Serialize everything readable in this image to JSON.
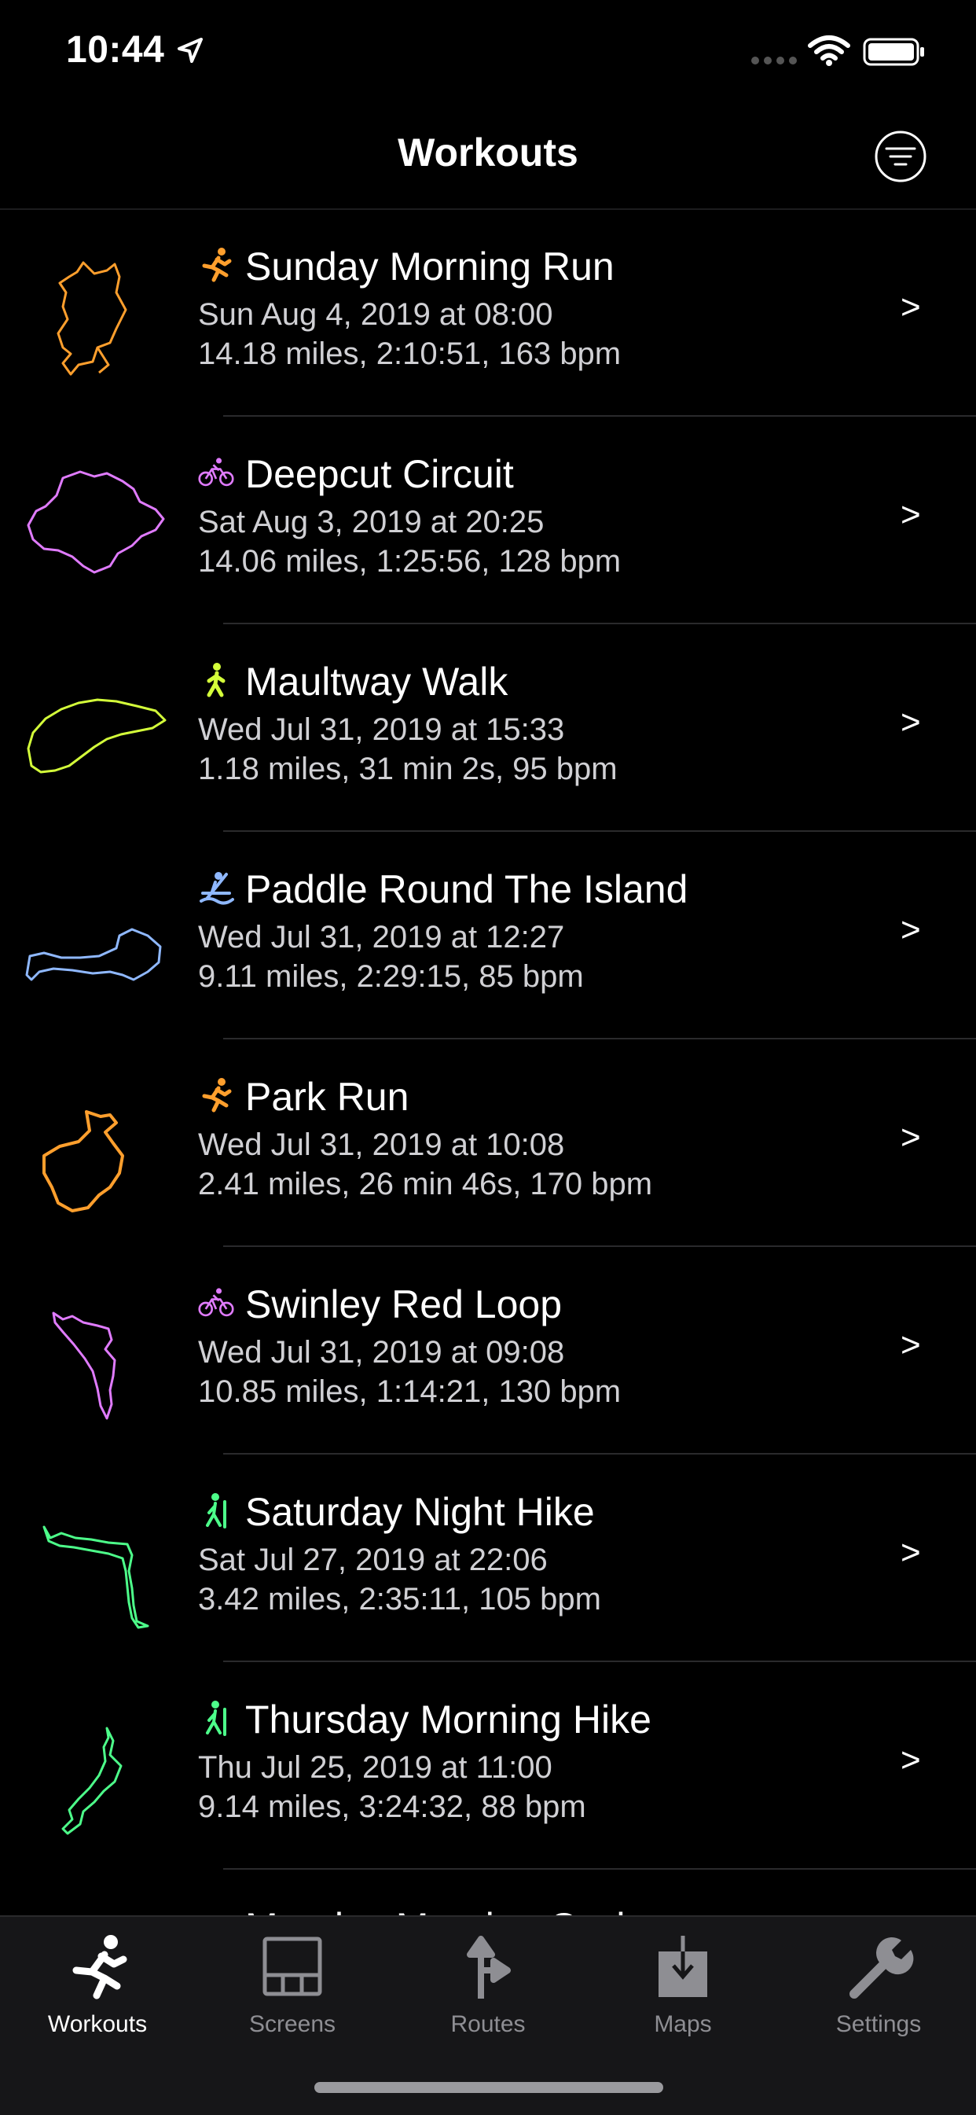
{
  "status": {
    "time": "10:44"
  },
  "nav": {
    "title": "Workouts"
  },
  "workouts": [
    {
      "title": "Sunday Morning Run",
      "date": "Sun Aug 4, 2019 at 08:00",
      "stats": "14.18 miles, 2:10:51, 163 bpm",
      "activity": "running-icon",
      "color": "#ff9f2d"
    },
    {
      "title": "Deepcut Circuit",
      "date": "Sat Aug 3, 2019 at 20:25",
      "stats": "14.06 miles, 1:25:56, 128 bpm",
      "activity": "cycling-icon",
      "color": "#e07bff"
    },
    {
      "title": "Maultway Walk",
      "date": "Wed Jul 31, 2019 at 15:33",
      "stats": "1.18 miles, 31 min 2s, 95 bpm",
      "activity": "walking-icon",
      "color": "#d4ff3a"
    },
    {
      "title": "Paddle Round The Island",
      "date": "Wed Jul 31, 2019 at 12:27",
      "stats": "9.11 miles, 2:29:15, 85 bpm",
      "activity": "paddling-icon",
      "color": "#8fb8ff"
    },
    {
      "title": "Park Run",
      "date": "Wed Jul 31, 2019 at 10:08",
      "stats": "2.41 miles, 26 min 46s, 170 bpm",
      "activity": "running-icon",
      "color": "#ff9f2d"
    },
    {
      "title": "Swinley Red Loop",
      "date": "Wed Jul 31, 2019 at 09:08",
      "stats": "10.85 miles, 1:14:21, 130 bpm",
      "activity": "cycling-icon",
      "color": "#e07bff"
    },
    {
      "title": "Saturday Night Hike",
      "date": "Sat Jul 27, 2019 at 22:06",
      "stats": "3.42 miles, 2:35:11, 105 bpm",
      "activity": "hiking-icon",
      "color": "#4dff8a"
    },
    {
      "title": "Thursday Morning Hike",
      "date": "Thu Jul 25, 2019 at 11:00",
      "stats": "9.14 miles, 3:24:32, 88 bpm",
      "activity": "hiking-icon",
      "color": "#4dff8a"
    },
    {
      "title": "Monday Morning Cycle",
      "date": "",
      "stats": "",
      "activity": "cycling-icon",
      "color": "#e07bff"
    }
  ],
  "tabs": [
    {
      "label": "Workouts",
      "icon": "runner-icon",
      "active": true
    },
    {
      "label": "Screens",
      "icon": "screens-icon",
      "active": false
    },
    {
      "label": "Routes",
      "icon": "routes-icon",
      "active": false
    },
    {
      "label": "Maps",
      "icon": "maps-download-icon",
      "active": false
    },
    {
      "label": "Settings",
      "icon": "wrench-icon",
      "active": false
    }
  ],
  "chevron": ">"
}
